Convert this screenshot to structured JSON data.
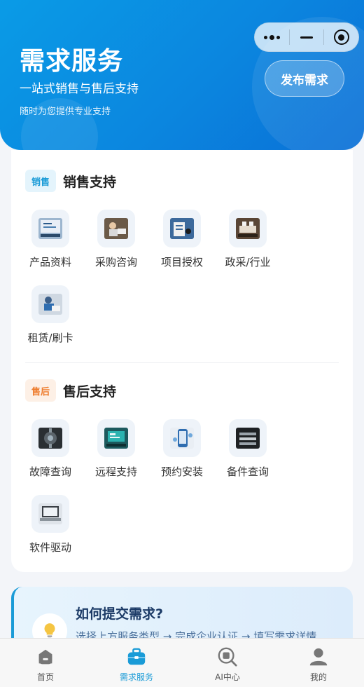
{
  "header": {
    "title": "需求服务",
    "subtitle": "一站式销售与售后支持",
    "note": "随时为您提供专业支持",
    "publish_button": "发布需求"
  },
  "sales": {
    "tag": "销售",
    "title": "销售支持",
    "items": [
      {
        "label": "产品资料",
        "icon": "product-docs-thumbnail"
      },
      {
        "label": "采购咨询",
        "icon": "purchase-consult-thumbnail"
      },
      {
        "label": "项目授权",
        "icon": "project-auth-thumbnail"
      },
      {
        "label": "政采/行业",
        "icon": "gov-industry-thumbnail"
      },
      {
        "label": "租赁/刷卡",
        "icon": "lease-card-thumbnail"
      }
    ]
  },
  "after_sales": {
    "tag": "售后",
    "title": "售后支持",
    "items": [
      {
        "label": "故障查询",
        "icon": "fault-query-thumbnail"
      },
      {
        "label": "远程支持",
        "icon": "remote-support-thumbnail"
      },
      {
        "label": "预约安装",
        "icon": "install-booking-thumbnail"
      },
      {
        "label": "备件查询",
        "icon": "spare-parts-thumbnail"
      },
      {
        "label": "软件驱动",
        "icon": "software-driver-thumbnail"
      }
    ]
  },
  "help": {
    "title": "如何提交需求?",
    "text": "选择上方服务类型 → 完成企业认证 → 填写需求详情"
  },
  "tabbar": {
    "items": [
      {
        "label": "首页",
        "icon": "home-icon",
        "active": false
      },
      {
        "label": "需求服务",
        "icon": "briefcase-icon",
        "active": true
      },
      {
        "label": "AI中心",
        "icon": "ai-search-icon",
        "active": false
      },
      {
        "label": "我的",
        "icon": "profile-icon",
        "active": false
      }
    ]
  },
  "colors": {
    "brand": "#0b86df",
    "sales_tag": "#1a9bd7",
    "after_tag": "#ee7d2e",
    "tab_active": "#1a9bd7"
  }
}
